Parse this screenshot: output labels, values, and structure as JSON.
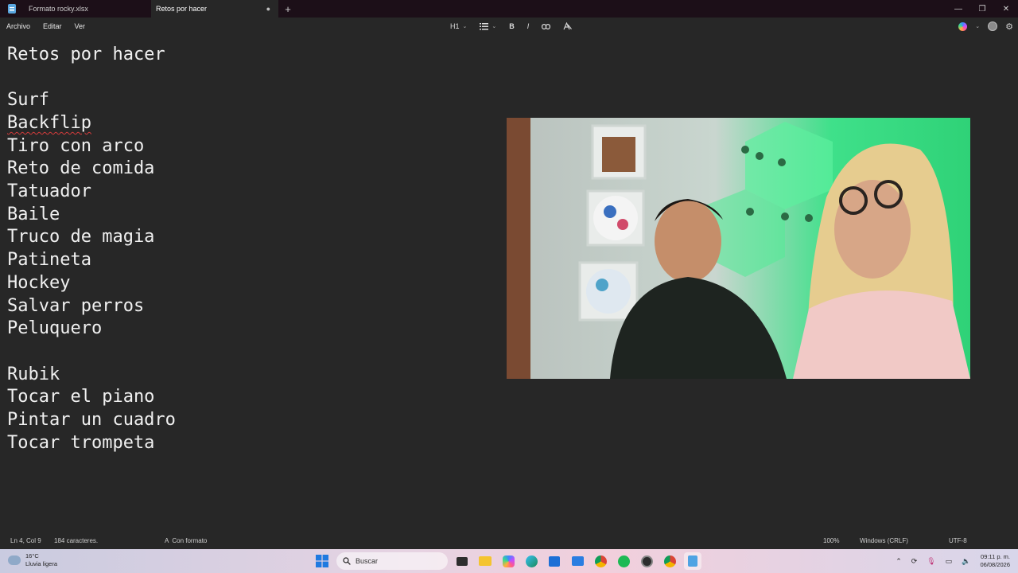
{
  "window": {
    "tabs": [
      {
        "label": "Formato rocky.xlsx",
        "active": false
      },
      {
        "label": "Retos por hacer",
        "active": true
      }
    ],
    "close_tab_glyph": "●",
    "add_tab_glyph": "+",
    "controls": {
      "minimize": "—",
      "maximize": "❐",
      "close": "✕"
    }
  },
  "menu": {
    "items": [
      "Archivo",
      "Editar",
      "Ver"
    ]
  },
  "toolbar": {
    "heading": "H1",
    "list_icon": "list-icon",
    "bold": "B",
    "italic": "I",
    "link_icon": "link-icon",
    "clear_format_icon": "clear-format-icon"
  },
  "editor": {
    "lines": [
      "Retos por hacer",
      "",
      "Surf",
      "Backflip",
      "Tiro con arco",
      "Reto de comida",
      "Tatuador",
      "Baile",
      "Truco de magia",
      "Patineta",
      "Hockey",
      "Salvar perros",
      "Peluquero",
      "",
      "Rubik",
      "Tocar el piano",
      "Pintar un cuadro",
      "Tocar trompeta"
    ]
  },
  "status": {
    "position": "Ln 4, Col 9",
    "chars": "184 caracteres.",
    "format": "Con formato",
    "zoom": "100%",
    "line_ending": "Windows (CRLF)",
    "encoding": "UTF-8"
  },
  "taskbar": {
    "weather_temp": "16°C",
    "weather_desc": "Lluvia ligera",
    "search_placeholder": "Buscar",
    "time": "09:11 p. m.",
    "date": "06/08/2026"
  },
  "colors": {
    "background": "#272727",
    "titlebar": "#1c0f18",
    "text": "#f0f0f0",
    "spell_error": "#d23b3b"
  }
}
